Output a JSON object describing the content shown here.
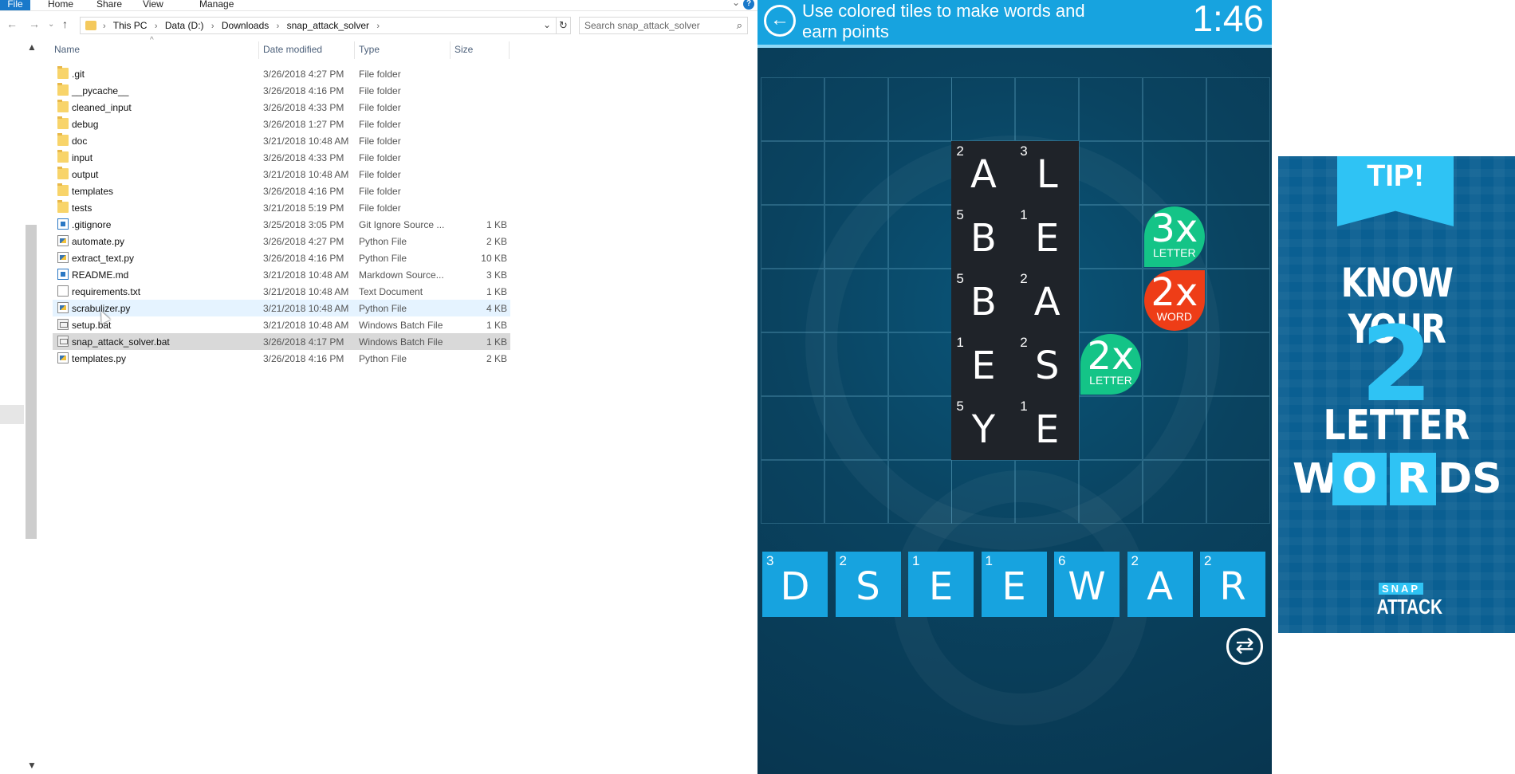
{
  "explorer": {
    "ribbon": {
      "tabs": [
        "File",
        "Home",
        "Share",
        "View",
        "Manage"
      ],
      "help": "?"
    },
    "address": {
      "crumbs": [
        "This PC",
        "Data (D:)",
        "Downloads",
        "snap_attack_solver"
      ]
    },
    "search": {
      "placeholder": "Search snap_attack_solver"
    },
    "columns": {
      "name": "Name",
      "date": "Date modified",
      "type": "Type",
      "size": "Size"
    },
    "files": [
      {
        "name": ".git",
        "date": "3/26/2018 4:27 PM",
        "type": "File folder",
        "size": "",
        "icon": "folder-icon"
      },
      {
        "name": "__pycache__",
        "date": "3/26/2018 4:16 PM",
        "type": "File folder",
        "size": "",
        "icon": "folder-icon"
      },
      {
        "name": "cleaned_input",
        "date": "3/26/2018 4:33 PM",
        "type": "File folder",
        "size": "",
        "icon": "folder-icon"
      },
      {
        "name": "debug",
        "date": "3/26/2018 1:27 PM",
        "type": "File folder",
        "size": "",
        "icon": "folder-icon"
      },
      {
        "name": "doc",
        "date": "3/21/2018 10:48 AM",
        "type": "File folder",
        "size": "",
        "icon": "folder-icon"
      },
      {
        "name": "input",
        "date": "3/26/2018 4:33 PM",
        "type": "File folder",
        "size": "",
        "icon": "folder-icon"
      },
      {
        "name": "output",
        "date": "3/21/2018 10:48 AM",
        "type": "File folder",
        "size": "",
        "icon": "folder-icon"
      },
      {
        "name": "templates",
        "date": "3/26/2018 4:16 PM",
        "type": "File folder",
        "size": "",
        "icon": "folder-icon"
      },
      {
        "name": "tests",
        "date": "3/21/2018 5:19 PM",
        "type": "File folder",
        "size": "",
        "icon": "folder-icon"
      },
      {
        "name": ".gitignore",
        "date": "3/25/2018 3:05 PM",
        "type": "Git Ignore Source ...",
        "size": "1 KB",
        "icon": "vscode-file-icon"
      },
      {
        "name": "automate.py",
        "date": "3/26/2018 4:27 PM",
        "type": "Python File",
        "size": "2 KB",
        "icon": "python-file-icon"
      },
      {
        "name": "extract_text.py",
        "date": "3/26/2018 4:16 PM",
        "type": "Python File",
        "size": "10 KB",
        "icon": "python-file-icon"
      },
      {
        "name": "README.md",
        "date": "3/21/2018 10:48 AM",
        "type": "Markdown Source...",
        "size": "3 KB",
        "icon": "vscode-file-icon"
      },
      {
        "name": "requirements.txt",
        "date": "3/21/2018 10:48 AM",
        "type": "Text Document",
        "size": "1 KB",
        "icon": "text-file-icon"
      },
      {
        "name": "scrabulizer.py",
        "date": "3/21/2018 10:48 AM",
        "type": "Python File",
        "size": "4 KB",
        "icon": "python-file-icon"
      },
      {
        "name": "setup.bat",
        "date": "3/21/2018 10:48 AM",
        "type": "Windows Batch File",
        "size": "1 KB",
        "icon": "batch-file-icon"
      },
      {
        "name": "snap_attack_solver.bat",
        "date": "3/26/2018 4:17 PM",
        "type": "Windows Batch File",
        "size": "1 KB",
        "icon": "batch-file-icon"
      },
      {
        "name": "templates.py",
        "date": "3/26/2018 4:16 PM",
        "type": "Python File",
        "size": "2 KB",
        "icon": "python-file-icon"
      }
    ],
    "hovered_row": "scrabulizer.py",
    "selected_row": "snap_attack_solver.bat"
  },
  "game": {
    "instruction": "Use colored tiles to make words and earn points",
    "timer": "1:46",
    "colors": {
      "topbar": "#17a3df",
      "tile": "#1f2329",
      "rack": "#17a3df",
      "bonus_letter": "#14c487",
      "bonus_word": "#ee3d17"
    },
    "board_tiles": [
      {
        "letter": "A",
        "points": "2",
        "row": 1,
        "col": 3
      },
      {
        "letter": "L",
        "points": "3",
        "row": 1,
        "col": 4
      },
      {
        "letter": "B",
        "points": "5",
        "row": 2,
        "col": 3
      },
      {
        "letter": "E",
        "points": "1",
        "row": 2,
        "col": 4
      },
      {
        "letter": "B",
        "points": "5",
        "row": 3,
        "col": 3
      },
      {
        "letter": "A",
        "points": "2",
        "row": 3,
        "col": 4
      },
      {
        "letter": "E",
        "points": "1",
        "row": 4,
        "col": 3
      },
      {
        "letter": "S",
        "points": "2",
        "row": 4,
        "col": 4
      },
      {
        "letter": "Y",
        "points": "5",
        "row": 5,
        "col": 3
      },
      {
        "letter": "E",
        "points": "1",
        "row": 5,
        "col": 4
      }
    ],
    "bonuses": [
      {
        "mult": "3x",
        "label": "LETTER",
        "kind": "green",
        "row": 2,
        "col": 6
      },
      {
        "mult": "2x",
        "label": "WORD",
        "kind": "red",
        "row": 3,
        "col": 6
      },
      {
        "mult": "2x",
        "label": "LETTER",
        "kind": "green",
        "row": 4,
        "col": 5
      }
    ],
    "rack": [
      {
        "letter": "D",
        "points": "3"
      },
      {
        "letter": "S",
        "points": "2"
      },
      {
        "letter": "E",
        "points": "1"
      },
      {
        "letter": "E",
        "points": "1"
      },
      {
        "letter": "W",
        "points": "6"
      },
      {
        "letter": "A",
        "points": "2"
      },
      {
        "letter": "R",
        "points": "2"
      }
    ]
  },
  "ad": {
    "tip": "TIP!",
    "line1": "KNOW YOUR",
    "number": "2",
    "line3": "LETTER",
    "line4": [
      "W",
      "O",
      "R",
      "DS"
    ],
    "logo_top": "SNAP",
    "logo_bottom": "ATTACK"
  }
}
